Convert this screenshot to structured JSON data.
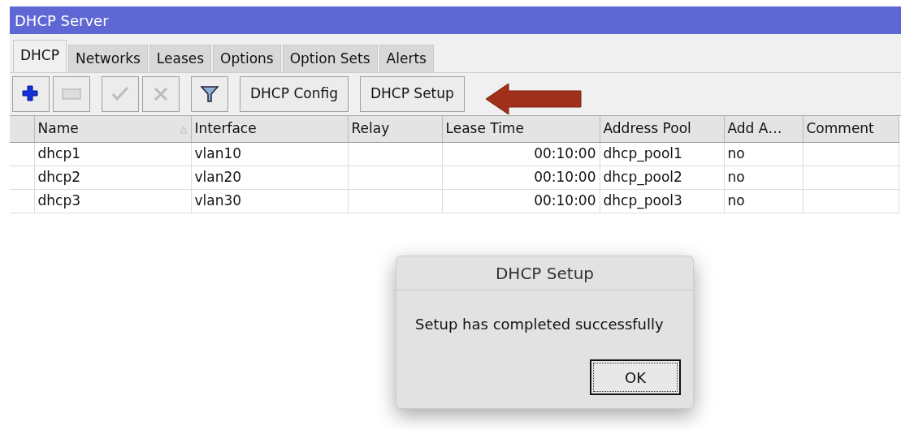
{
  "window": {
    "title": "DHCP Server"
  },
  "tabs": [
    {
      "label": "DHCP",
      "selected": true
    },
    {
      "label": "Networks",
      "selected": false
    },
    {
      "label": "Leases",
      "selected": false
    },
    {
      "label": "Options",
      "selected": false
    },
    {
      "label": "Option Sets",
      "selected": false
    },
    {
      "label": "Alerts",
      "selected": false
    }
  ],
  "toolbar": [
    {
      "kind": "add",
      "disabled": false
    },
    {
      "kind": "remove",
      "disabled": true
    },
    {
      "kind": "enable",
      "disabled": true
    },
    {
      "kind": "disable",
      "disabled": true
    },
    {
      "kind": "filter",
      "disabled": false
    },
    {
      "kind": "text",
      "label": "DHCP Config",
      "disabled": false
    },
    {
      "kind": "text",
      "label": "DHCP Setup",
      "disabled": false
    }
  ],
  "table": {
    "columns": [
      {
        "label": "Name",
        "sorted": true
      },
      {
        "label": "Interface",
        "sorted": false
      },
      {
        "label": "Relay",
        "sorted": false
      },
      {
        "label": "Lease Time",
        "sorted": false
      },
      {
        "label": "Address Pool",
        "sorted": false
      },
      {
        "label": "Add A…",
        "sorted": false
      },
      {
        "label": "Comment",
        "sorted": false
      }
    ],
    "rows": [
      [
        "dhcp1",
        "vlan10",
        "",
        "00:10:00",
        "dhcp_pool1",
        "no",
        ""
      ],
      [
        "dhcp2",
        "vlan20",
        "",
        "00:10:00",
        "dhcp_pool2",
        "no",
        ""
      ],
      [
        "dhcp3",
        "vlan30",
        "",
        "00:10:00",
        "dhcp_pool3",
        "no",
        ""
      ]
    ]
  },
  "dialog": {
    "title": "DHCP Setup",
    "message": "Setup has completed successfully",
    "button": {
      "label": "OK",
      "focused": true
    }
  }
}
